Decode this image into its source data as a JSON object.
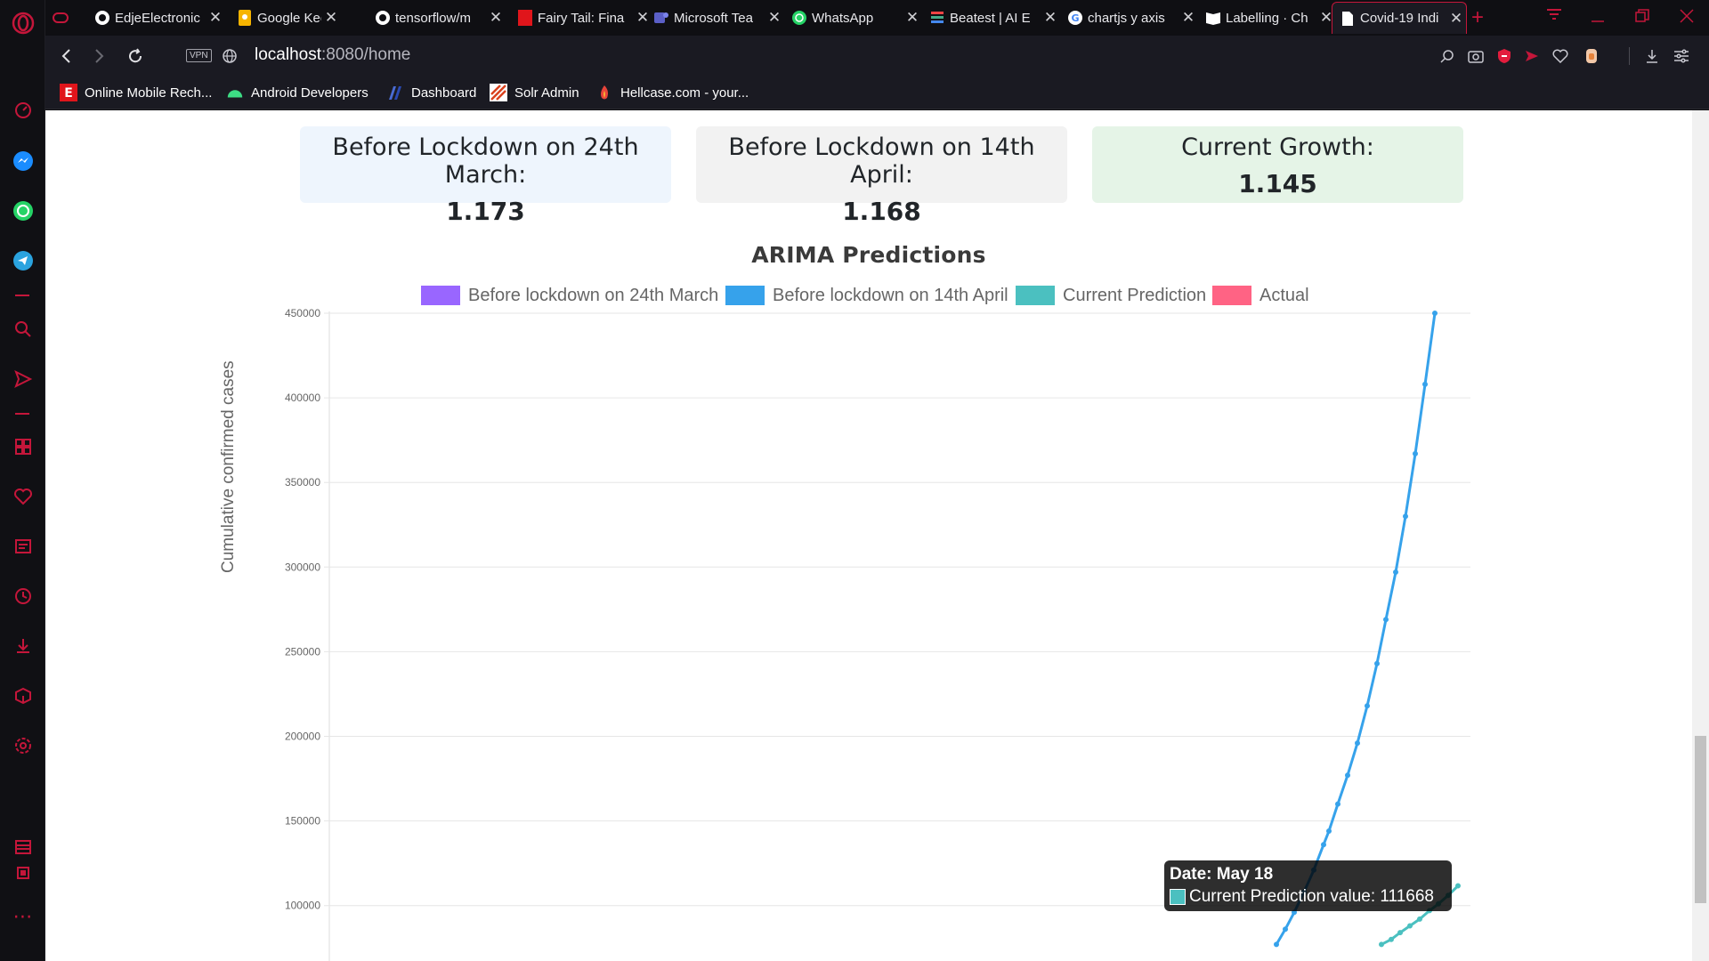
{
  "browser": {
    "tabs": [
      {
        "title": "",
        "icon": "gamepad-icon"
      },
      {
        "title": "EdjeElectronic",
        "icon": "github-icon"
      },
      {
        "title": "Google Keep",
        "icon": "keep-icon"
      },
      {
        "title": "tensorflow/m",
        "icon": "github-icon"
      },
      {
        "title": "Fairy Tail: Fina",
        "icon": "anime-icon"
      },
      {
        "title": "Microsoft Tea",
        "icon": "teams-icon"
      },
      {
        "title": "WhatsApp",
        "icon": "whatsapp-icon"
      },
      {
        "title": "Beatest | AI E",
        "icon": "book-icon"
      },
      {
        "title": "chartjs y axis",
        "icon": "google-icon"
      },
      {
        "title": "Labelling · Ch",
        "icon": "book-icon"
      },
      {
        "title": "Covid-19 Indi",
        "icon": "document-icon"
      }
    ],
    "address": {
      "vpn": "VPN",
      "host": "localhost",
      "path": ":8080/home"
    },
    "bookmarks": [
      {
        "label": "Online Mobile Rech...",
        "icon": "e-icon"
      },
      {
        "label": "Android Developers",
        "icon": "android-icon"
      },
      {
        "label": "Dashboard",
        "icon": "dashboard-icon"
      },
      {
        "label": "Solr Admin",
        "icon": "solr-icon"
      },
      {
        "label": "Hellcase.com - your...",
        "icon": "hellcase-icon"
      }
    ]
  },
  "cards": [
    {
      "title": "Before Lockdown on 24th March:",
      "value": "1.173",
      "bg": "#eef5fd"
    },
    {
      "title": "Before Lockdown on 14th April:",
      "value": "1.168",
      "bg": "#f2f2f2"
    },
    {
      "title": "Current Growth:",
      "value": "1.145",
      "bg": "#e5f4e7"
    }
  ],
  "chart_data": {
    "type": "line",
    "title": "ARIMA Predictions",
    "ylabel": "Cumulative confirmed cases",
    "xlabel": "",
    "ylim": [
      0,
      450000
    ],
    "y_ticks": [
      "450000",
      "400000",
      "350000",
      "300000",
      "250000",
      "200000",
      "150000",
      "100000"
    ],
    "grid": true,
    "legend_position": "top",
    "legend": [
      {
        "name": "Before lockdown on 24th March",
        "color": "#9966ff"
      },
      {
        "name": "Before lockdown on 14th April",
        "color": "#36a2eb"
      },
      {
        "name": "Current Prediction",
        "color": "#4bc0c0"
      },
      {
        "name": "Actual",
        "color": "#ff6384"
      }
    ],
    "series": [
      {
        "name": "Before lockdown on 14th April",
        "color": "#36a2eb",
        "values": [
          77000,
          86000,
          96000,
          108000,
          121000,
          136000,
          144000,
          160000,
          177000,
          196000,
          218000,
          243000,
          269000,
          297000,
          330000,
          367000,
          408000,
          450000
        ]
      },
      {
        "name": "Current Prediction",
        "color": "#4bc0c0",
        "values": [
          77000,
          80000,
          84000,
          88000,
          92000,
          97000,
          101000,
          106000,
          111668
        ]
      }
    ],
    "tooltip": {
      "title": "Date: May 18",
      "label": "Current Prediction value: 111668",
      "color": "#4bc0c0"
    }
  }
}
